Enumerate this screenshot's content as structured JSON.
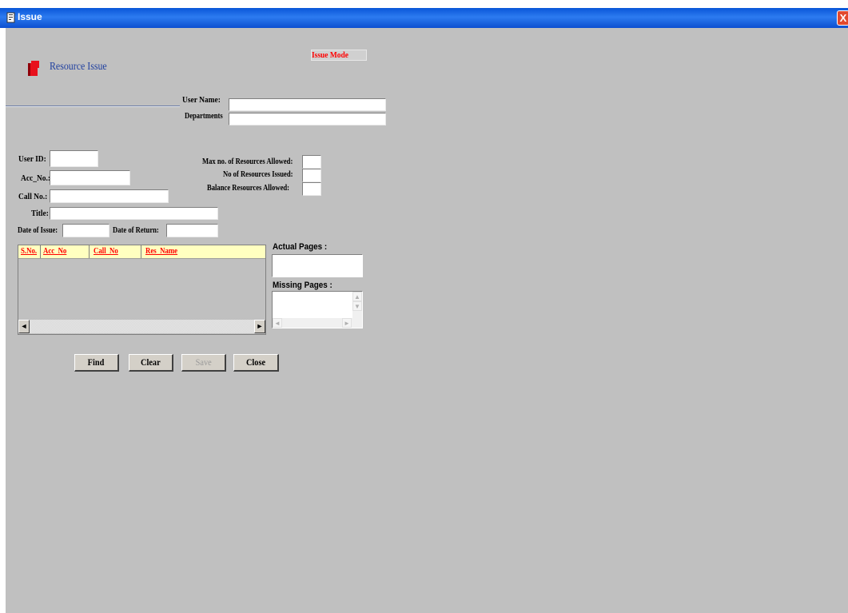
{
  "window": {
    "title": "Issue",
    "close_glyph": "X"
  },
  "header": {
    "section_title": "Resource Issue",
    "mode_label": "Issue Mode",
    "logo_icon": "book-icon"
  },
  "user": {
    "user_name_label": "User Name:",
    "user_name_value": "",
    "departments_label": "Departments",
    "departments_value": ""
  },
  "form": {
    "user_id_label": "User ID:",
    "acc_no_label": "Acc_No.:",
    "call_no_label": "Call No.:",
    "title_label": "Title:",
    "date_of_issue_label": "Date of Issue:",
    "date_of_return_label": "Date of Return:",
    "user_id": "",
    "acc_no": "",
    "call_no": "",
    "title": "",
    "date_of_issue": "",
    "date_of_return": ""
  },
  "limits": {
    "max_allowed_label": "Max no. of Resources Allowed:",
    "issued_label": "No of Resources Issued:",
    "balance_label": "Balance Resources Allowed:",
    "max_allowed": "",
    "issued": "",
    "balance": ""
  },
  "grid": {
    "columns": [
      "S.No.",
      "Acc_No",
      "Call_No",
      "Res_Name"
    ],
    "rows": []
  },
  "pages": {
    "actual_label": "Actual Pages :",
    "missing_label": "Missing Pages :",
    "actual_value": "",
    "missing_value": ""
  },
  "buttons": {
    "find": "Find",
    "clear": "Clear",
    "save": "Save",
    "close": "Close"
  },
  "colors": {
    "titlebar": "#0a56d8",
    "client_bg": "#c0c0c0",
    "header_text": "#ff0000",
    "section_title": "#1f3f9f",
    "grid_header_bg": "#ffffc0"
  }
}
